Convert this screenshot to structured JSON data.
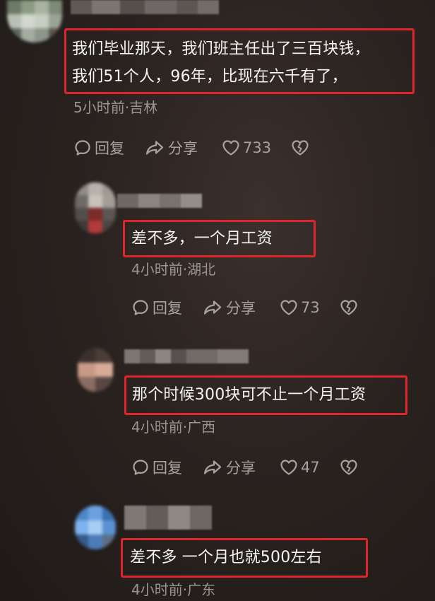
{
  "comments": [
    {
      "text_lines": [
        "我们毕业那天，我们班主任出了三百块钱，",
        "我们51个人，96年，比现在六千有了，"
      ],
      "meta": "5小时前·吉林",
      "reply_label": "回复",
      "share_label": "分享",
      "like_count": "733"
    },
    {
      "text": "差不多，一个月工资",
      "meta": "4小时前·湖北",
      "reply_label": "回复",
      "share_label": "分享",
      "like_count": "73"
    },
    {
      "text": "那个时候300块可不止一个月工资",
      "meta": "4小时前·广西",
      "reply_label": "回复",
      "share_label": "分享",
      "like_count": "47"
    },
    {
      "text": "差不多 一个月也就500左右",
      "meta": "4小时前·广东"
    }
  ],
  "icons": {
    "reply": "comment-bubble-icon",
    "share": "share-arrow-icon",
    "like": "heart-outline-icon",
    "dislike": "broken-heart-icon"
  },
  "colors": {
    "highlight_border": "#e0262d",
    "background": "#2a2320",
    "meta_text": "#9a9590",
    "action_text": "#a8a39f"
  }
}
